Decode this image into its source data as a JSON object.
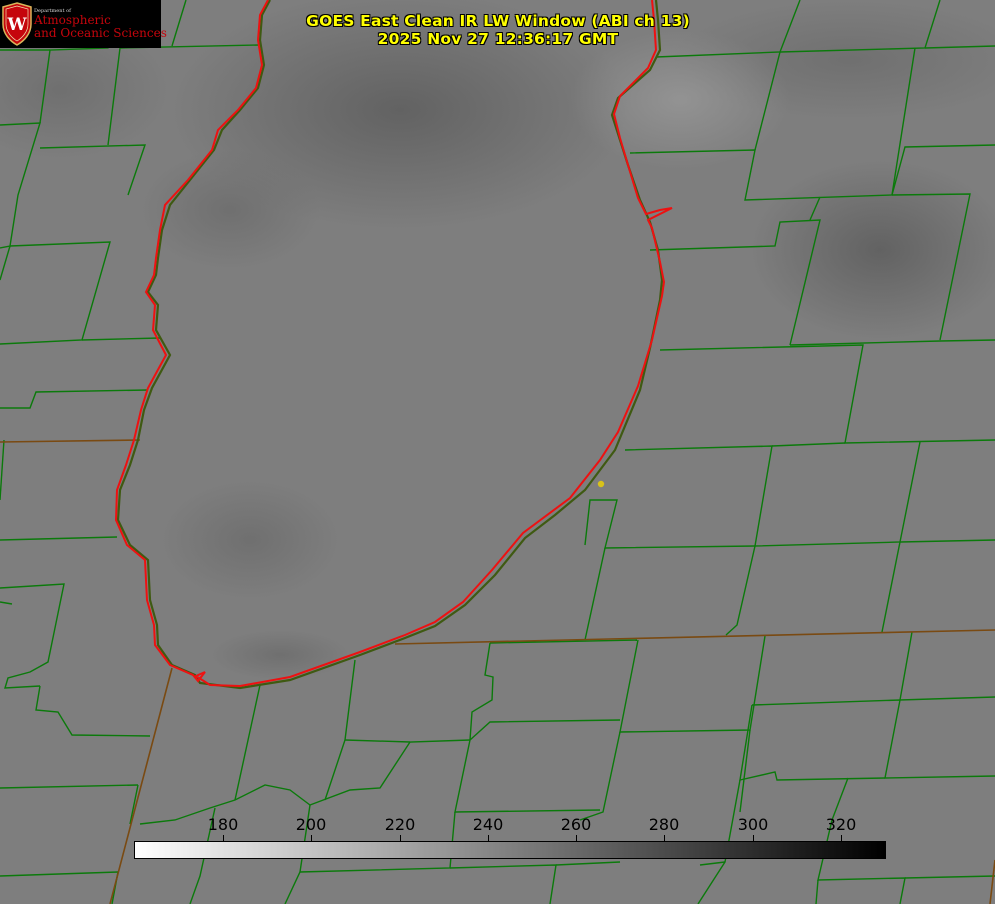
{
  "title": {
    "line1": "GOES East Clean IR LW Window (ABI ch 13)",
    "line2": "2025 Nov 27 12:36:17 GMT"
  },
  "logo": {
    "dept": "Department of",
    "line1": "Atmospheric",
    "line2": "and Oceanic Sciences",
    "emblem_letter": "W"
  },
  "colorbar": {
    "min": 160,
    "max": 330,
    "ticks": [
      "180",
      "200",
      "220",
      "240",
      "260",
      "280",
      "300",
      "320"
    ],
    "tick_values": [
      180,
      200,
      220,
      240,
      260,
      280,
      300,
      320
    ],
    "colormap": "white-to-black",
    "start_color": "#ffffff",
    "end_color": "#000000"
  },
  "colors": {
    "county_lines": "#0b7a0b",
    "coastline": "#ee1111",
    "title": "#ffff00",
    "marker": "#d8c21a",
    "logo_red": "#c5050c"
  },
  "map": {
    "feature": "lake-outline",
    "marker": "yellow-dot"
  }
}
